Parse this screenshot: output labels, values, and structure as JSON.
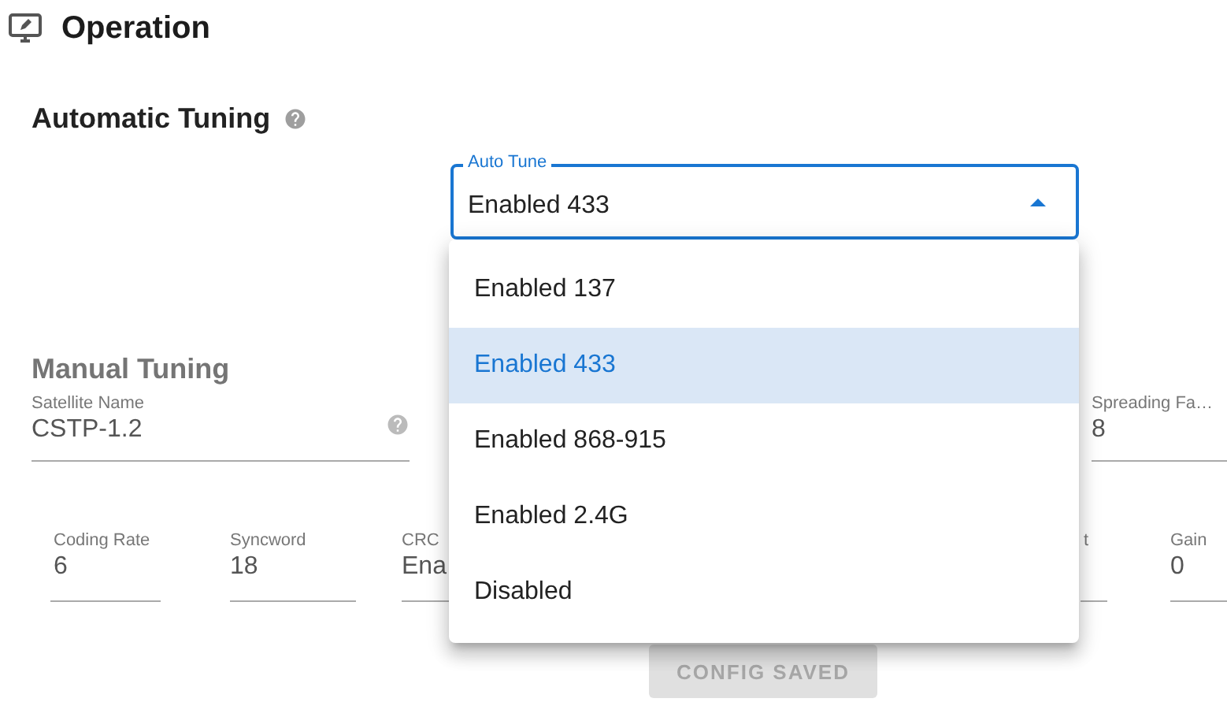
{
  "header": {
    "title": "Operation"
  },
  "automatic_tuning": {
    "title": "Automatic Tuning",
    "auto_tune": {
      "label": "Auto Tune",
      "value": "Enabled 433",
      "expanded": true
    }
  },
  "manual_tuning": {
    "title": "Manual Tuning",
    "top_fields": [
      {
        "label": "Satellite Name",
        "value": "CSTP-1.2",
        "help": true
      },
      {
        "label": "Spreading Fa…",
        "value": "8",
        "help": false
      }
    ],
    "fields": [
      {
        "label": "Coding Rate",
        "value": "6"
      },
      {
        "label": "Syncword",
        "value": "18"
      },
      {
        "label": "CRC",
        "value": "Ena"
      },
      {
        "label": "t"
      },
      {
        "label": "Gain",
        "value": "0"
      }
    ]
  },
  "button": {
    "label": "CONFIG SAVED",
    "disabled": true
  },
  "menu": {
    "options": [
      {
        "label": "Enabled 137",
        "selected": false
      },
      {
        "label": "Enabled 433",
        "selected": true
      },
      {
        "label": "Enabled 868-915",
        "selected": false
      },
      {
        "label": "Enabled 2.4G",
        "selected": false
      },
      {
        "label": "Disabled",
        "selected": false
      }
    ]
  }
}
